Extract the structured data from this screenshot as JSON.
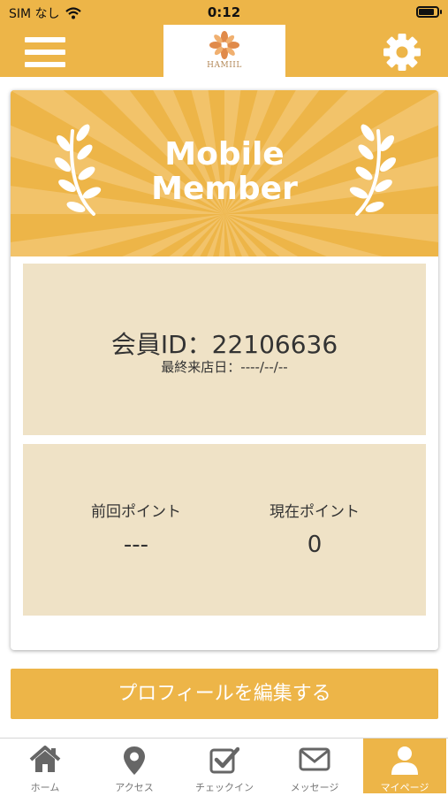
{
  "status_bar": {
    "carrier": "SIM なし",
    "time": "0:12",
    "battery_level": 0.85
  },
  "header": {
    "logo_text": "HAMIIL",
    "menu_icon": "hamburger-menu-icon",
    "settings_icon": "gear-icon"
  },
  "card": {
    "title_line1": "Mobile",
    "title_line2": "Member",
    "member_id": "会員ID：22106636",
    "last_visit": "最終来店日：----/--/--",
    "previous_points_label": "前回ポイント",
    "previous_points_value": "---",
    "current_points_label": "現在ポイント",
    "current_points_value": "0"
  },
  "edit_profile_label": "プロフィールを編集する",
  "tabs": [
    {
      "label": "ホーム",
      "icon": "home-icon",
      "active": false
    },
    {
      "label": "アクセス",
      "icon": "map-pin-icon",
      "active": false
    },
    {
      "label": "チェックイン",
      "icon": "checkbox-icon",
      "active": false
    },
    {
      "label": "メッセージ",
      "icon": "envelope-icon",
      "active": false
    },
    {
      "label": "マイページ",
      "icon": "user-icon",
      "active": true
    }
  ],
  "colors": {
    "accent": "#edb548",
    "panel": "#efe2c6",
    "text": "#333333"
  }
}
